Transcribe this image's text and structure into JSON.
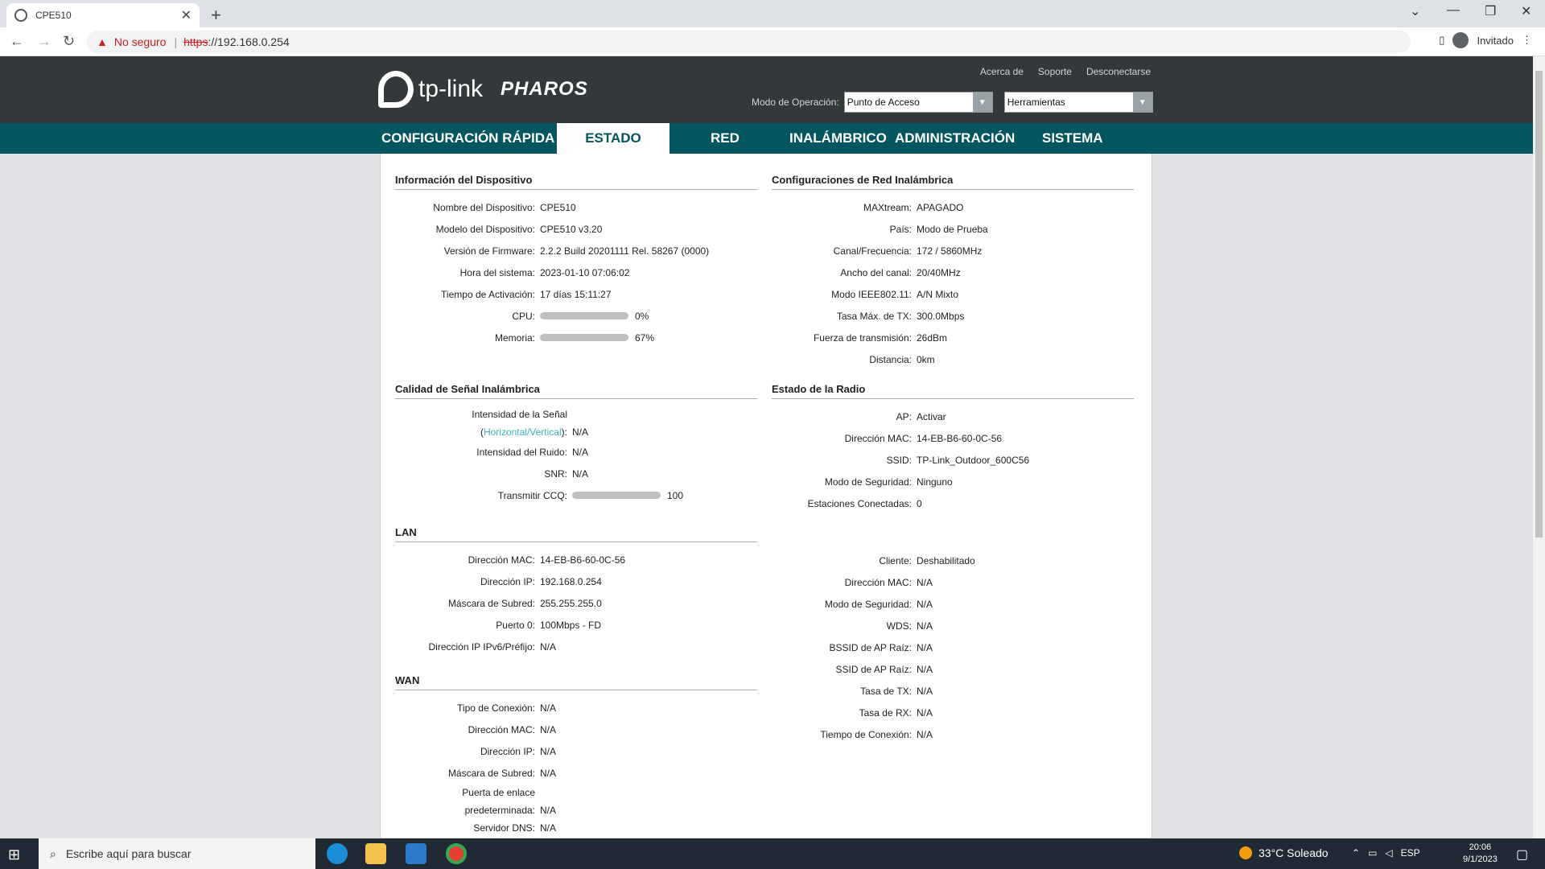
{
  "browser": {
    "tab_title": "CPE510",
    "security_label": "No seguro",
    "url_scheme": "https",
    "url_rest": "://192.168.0.254",
    "profile_label": "Invitado"
  },
  "header": {
    "brand": "tp-link",
    "product": "PHAROS",
    "links": [
      "Acerca de",
      "Soporte",
      "Desconectarse"
    ],
    "opmode_label": "Modo de Operación:",
    "opmode_value": "Punto de Acceso",
    "tools_value": "Herramientas"
  },
  "nav": {
    "items": [
      "CONFIGURACIÓN RÁPIDA",
      "ESTADO",
      "RED",
      "INALÁMBRICO",
      "ADMINISTRACIÓN",
      "SISTEMA"
    ],
    "active": "ESTADO"
  },
  "device_info": {
    "title": "Información del Dispositivo",
    "rows": [
      {
        "label": "Nombre del Dispositivo:",
        "value": "CPE510"
      },
      {
        "label": "Modelo del Dispositivo:",
        "value": "CPE510 v3.20"
      },
      {
        "label": "Versión de Firmware:",
        "value": "2.2.2 Build 20201111 Rel. 58267 (0000)"
      },
      {
        "label": "Hora del sistema:",
        "value": "2023-01-10 07:06:02"
      },
      {
        "label": "Tiempo de Activación:",
        "value": "17 días 15:11:27"
      }
    ],
    "cpu_label": "CPU:",
    "cpu_value": "0%",
    "cpu_percent": 0,
    "mem_label": "Memoria:",
    "mem_value": "67%",
    "mem_percent": 67
  },
  "wireless_config": {
    "title": "Configuraciones de Red Inalámbrica",
    "rows": [
      {
        "label": "MAXtream:",
        "value": "APAGADO"
      },
      {
        "label": "País:",
        "value": "Modo de Prueba"
      },
      {
        "label": "Canal/Frecuencia:",
        "value": "172 / 5860MHz"
      },
      {
        "label": "Ancho del canal:",
        "value": "20/40MHz"
      },
      {
        "label": "Modo IEEE802.11:",
        "value": "A/N Mixto"
      },
      {
        "label": "Tasa Máx. de TX:",
        "value": "300.0Mbps"
      },
      {
        "label": "Fuerza de transmisión:",
        "value": "26dBm"
      },
      {
        "label": "Distancia:",
        "value": "0km"
      }
    ]
  },
  "signal_quality": {
    "title": "Calidad de Señal Inalámbrica",
    "signal_label_1": "Intensidad de la Señal",
    "signal_paren_open": "(",
    "signal_link": "Horizontal/Vertical",
    "signal_paren_close": "):",
    "signal_value": "N/A",
    "rows": [
      {
        "label": "Intensidad del Ruido:",
        "value": "N/A"
      },
      {
        "label": "SNR:",
        "value": "N/A"
      }
    ],
    "ccq_label": "Transmitir CCQ:",
    "ccq_value": "100",
    "ccq_percent": 100
  },
  "radio_status": {
    "title": "Estado de la Radio",
    "rows": [
      {
        "label": "AP:",
        "value": "Activar"
      },
      {
        "label": "Dirección MAC:",
        "value": "14-EB-B6-60-0C-56"
      },
      {
        "label": "SSID:",
        "value": "TP-Link_Outdoor_600C56"
      },
      {
        "label": "Modo de Seguridad:",
        "value": "Ninguno"
      },
      {
        "label": "Estaciones Conectadas:",
        "value": "0"
      }
    ],
    "client_rows": [
      {
        "label": "Cliente:",
        "value": "Deshabilitado"
      },
      {
        "label": "Dirección MAC:",
        "value": "N/A"
      },
      {
        "label": "Modo de Seguridad:",
        "value": "N/A"
      },
      {
        "label": "WDS:",
        "value": "N/A"
      },
      {
        "label": "BSSID de AP Raíz:",
        "value": "N/A"
      },
      {
        "label": "SSID de AP Raíz:",
        "value": "N/A"
      },
      {
        "label": "Tasa de TX:",
        "value": "N/A"
      },
      {
        "label": "Tasa de RX:",
        "value": "N/A"
      },
      {
        "label": "Tiempo de Conexión:",
        "value": "N/A"
      }
    ]
  },
  "lan": {
    "title": "LAN",
    "rows": [
      {
        "label": "Dirección MAC:",
        "value": "14-EB-B6-60-0C-56"
      },
      {
        "label": "Dirección IP:",
        "value": "192.168.0.254"
      },
      {
        "label": "Máscara de Subred:",
        "value": "255.255.255.0"
      },
      {
        "label": "Puerto 0:",
        "value": "100Mbps - FD"
      },
      {
        "label": "Dirección IP IPv6/Préfijo:",
        "value": "N/A"
      }
    ]
  },
  "wan": {
    "title": "WAN",
    "rows": [
      {
        "label": "Tipo de Conexión:",
        "value": "N/A"
      },
      {
        "label": "Dirección MAC:",
        "value": "N/A"
      },
      {
        "label": "Dirección IP:",
        "value": "N/A"
      },
      {
        "label": "Máscara de Subred:",
        "value": "N/A"
      }
    ],
    "gateway_label_1": "Puerta de enlace",
    "gateway_label_2": "predeterminada:",
    "gateway_value": "N/A",
    "dns_label": "Servidor DNS:",
    "dns_value": "N/A"
  },
  "taskbar": {
    "search_placeholder": "Escribe aquí para buscar",
    "weather": "33°C  Soleado",
    "lang": "ESP",
    "time": "20:06",
    "date": "9/1/2023"
  }
}
